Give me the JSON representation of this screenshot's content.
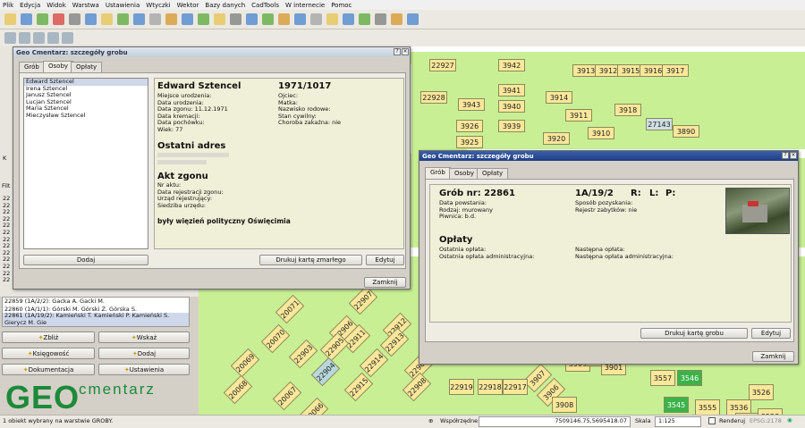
{
  "menu": [
    "Plik",
    "Edycja",
    "Widok",
    "Warstwa",
    "Ustawienia",
    "Wtyczki",
    "Wektor",
    "Bazy danych",
    "CadTools",
    "W internecie",
    "Pomoc"
  ],
  "map": {
    "plots": [
      "22927",
      "3942",
      "3913",
      "3912",
      "3915",
      "3916",
      "3917",
      "22928",
      "3941",
      "3943",
      "3940",
      "3914",
      "3918",
      "27143",
      "3926",
      "3939",
      "3911",
      "3890",
      "3925",
      "3920",
      "3910",
      "22907",
      "22912",
      "20071",
      "22906",
      "22913",
      "22911",
      "20070",
      "22903",
      "22905",
      "22914",
      "22909",
      "20069",
      "22904",
      "22915",
      "22908",
      "20068",
      "20067",
      "20066",
      "3907",
      "3906",
      "3908",
      "3909",
      "3557",
      "3546",
      "3545",
      "3526",
      "3555",
      "3536",
      "3537",
      "3528",
      "22919",
      "22918",
      "22917",
      "22916",
      "22910",
      "3905",
      "3904",
      "3903",
      "3902",
      "3901"
    ]
  },
  "win1": {
    "title": "Geo Cmentarz: szczegóły grobu",
    "tabs": [
      "Grób",
      "Osoby",
      "Opłaty"
    ],
    "persons": [
      "Edward Sztencel",
      "Irena Sztencel",
      "Janusz Sztencel",
      "Lucjan Sztencel",
      "Maria Sztencel",
      "Mieczysław Sztencel"
    ],
    "name": "Edward Sztencel",
    "years": "1971/1017",
    "fields_left": [
      "Miejsce urodzenia:",
      "Data urodzenia:",
      "Data zgonu: 11.12.1971",
      "Data kremacji:",
      "Data pochówku:",
      "Wiek: 77"
    ],
    "fields_right": [
      "Ojciec:",
      "Matka:",
      "Nazwisko rodowe:",
      "Stan cywilny:",
      "Choroba zakaźna: nie"
    ],
    "address_title": "Ostatni adres",
    "death_title": "Akt zgonu",
    "death_fields": [
      "Nr aktu:",
      "Data rejestracji zgonu:",
      "Urząd rejestrujący:",
      "Siedziba urzędu:"
    ],
    "note": "były więzień polityczny Oświęcimia",
    "btn_add": "Dodaj",
    "btn_print": "Drukuj kartę zmarłego",
    "btn_edit": "Edytuj",
    "btn_close": "Zamknij"
  },
  "win2": {
    "title": "Geo Cmentarz: szczegóły grobu",
    "tabs": [
      "Grób",
      "Osoby",
      "Opłaty"
    ],
    "grave": "Grób nr: 22861",
    "location": "1A/19/2",
    "r": "R:",
    "l": "L:",
    "p": "P:",
    "fields_left": [
      "Data powstania:",
      "Rodzaj: murowany",
      "Piwnica: b.d."
    ],
    "fields_right": [
      "Sposób pozyskania:",
      "Rejestr zabytków: nie"
    ],
    "fees_title": "Opłaty",
    "fees_left": [
      "Ostatnia opłata:",
      "Ostatnia opłata administracyjna:"
    ],
    "fees_right": [
      "Następna opłata:",
      "Następna opłata administracyjna:"
    ],
    "btn_print": "Drukuj kartę grobu",
    "btn_edit": "Edytuj",
    "btn_close": "Zamknij"
  },
  "left": {
    "filter_label": "Filt",
    "side_labels": [
      "K"
    ],
    "rows": [
      "22859 (1A/2/2): Gacka A. Gacki M.",
      "22860 (1A/1/1): Górski M. Górski Z. Górska S.",
      "22861 (1A/19/2): Kamieński T. Kamieński P. Kamieński S. Gierycz M. Gie"
    ],
    "num_rows": [
      "22",
      "22",
      "22",
      "22",
      "22",
      "22",
      "22",
      "22",
      "22",
      "22",
      "22",
      "22",
      "22"
    ],
    "buttons": [
      "Zbliż",
      "Wskaż",
      "Księgowość",
      "Dodaj",
      "Dokumentacja",
      "Ustawienia"
    ],
    "logo_main": "GEO",
    "logo_sub": "cmentarz"
  },
  "status": {
    "message": "1 obiekt wybrany na warstwie GROBY.",
    "coord_label": "Współrzędne:",
    "coords": "7509146.75,5695418.07",
    "scale_label": "Skala",
    "scale": "1:125",
    "render": "Renderuj",
    "epsg": "EPSG:2178"
  }
}
